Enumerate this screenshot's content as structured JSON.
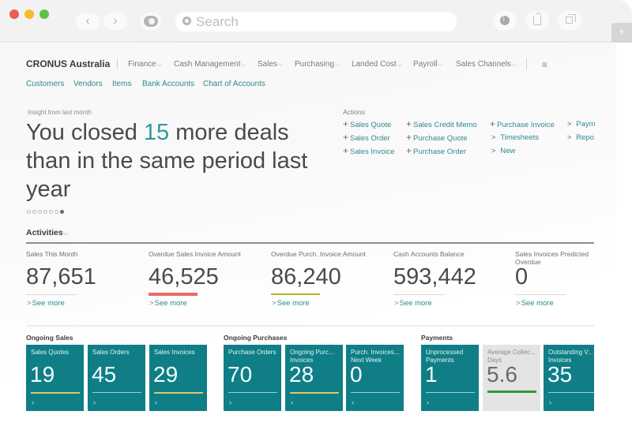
{
  "browser": {
    "search_placeholder": "Search",
    "back_icon": "‹",
    "forward_icon": "›",
    "new_tab_icon": "+"
  },
  "header": {
    "brand": "CRONUS Australia",
    "menus": [
      {
        "label": "Finance"
      },
      {
        "label": "Cash Management"
      },
      {
        "label": "Sales"
      },
      {
        "label": "Purchasing"
      },
      {
        "label": "Landed Cost"
      },
      {
        "label": "Payroll"
      },
      {
        "label": "Sales Channels"
      }
    ],
    "chevron": "⌵",
    "hamburger": "≡",
    "sublinks": [
      "Customers",
      "Vendors",
      "Items",
      "Bank Accounts",
      "Chart of Accounts"
    ]
  },
  "insight": {
    "label": "Insight from last month",
    "headline_pre": "You closed ",
    "headline_num": "15",
    "headline_post": " more deals than in the same period last year",
    "pager_count": 7,
    "pager_active": 7
  },
  "actions": {
    "label": "Actions",
    "items": [
      {
        "icon": "+",
        "label": "Sales Quote"
      },
      {
        "icon": "+",
        "label": "Sales Order"
      },
      {
        "icon": "+",
        "label": "Sales Invoice"
      },
      {
        "icon": "+",
        "label": "Sales Credit Memo"
      },
      {
        "icon": "+",
        "label": "Purchase Quote"
      },
      {
        "icon": "+",
        "label": "Purchase Order"
      },
      {
        "icon": "+",
        "label": "Purchase Invoice"
      },
      {
        "icon": ">",
        "label": "Timesheets"
      },
      {
        "icon": ">",
        "label": "New"
      },
      {
        "icon": ">",
        "label": "Paym"
      },
      {
        "icon": ">",
        "label": "Repo"
      }
    ]
  },
  "activities": {
    "title": "Activities",
    "chevron": "⌵",
    "see_more": "See more",
    "see_more_icon": ">",
    "kpis": [
      {
        "label": "Sales This Month",
        "value": "87,651"
      },
      {
        "label": "Overdue Sales Invoice Amount",
        "value": "46,525"
      },
      {
        "label": "Overdue Purch. Invoice Amount",
        "value": "86,240"
      },
      {
        "label": "Cash Accounts Balance",
        "value": "593,442"
      },
      {
        "label": "Sales Invoices Predicted Overdue",
        "value": "0"
      }
    ]
  },
  "groups": [
    {
      "title": "Ongoing Sales",
      "tiles": [
        {
          "label": "Sales Quotes",
          "value": "19"
        },
        {
          "label": "Sales Orders",
          "value": "45"
        },
        {
          "label": "Sales Invoices",
          "value": "29"
        }
      ]
    },
    {
      "title": "Ongoing Purchases",
      "tiles": [
        {
          "label": "Purchase Orders",
          "value": "70"
        },
        {
          "label": "Ongoing Purc... Invoices",
          "label1": "Ongoing Purc...",
          "label2": "Invoices",
          "value": "28"
        },
        {
          "label": "Purch. Invoices... Next Week",
          "label1": "Purch. Invoices...",
          "label2": "Next Week",
          "value": "0"
        }
      ]
    },
    {
      "title": "Payments",
      "tiles": [
        {
          "label1": "Unprocessed",
          "label2": "Payments",
          "value": "1"
        },
        {
          "label1": "Average Collec...",
          "label2": "Days",
          "value": "5.6"
        },
        {
          "label1": "Outstanding V...",
          "label2": "Invoices",
          "value": "35"
        }
      ]
    }
  ],
  "tile_arrow": "›",
  "colors": {
    "accent": "#2e8a8a",
    "tile": "#0f7e86",
    "tile_grey": "#e4e4e4",
    "overdue_red": "#e86b6b",
    "olive": "#b5b52a",
    "gold": "#e2c66b",
    "green": "#2f9a2f"
  }
}
